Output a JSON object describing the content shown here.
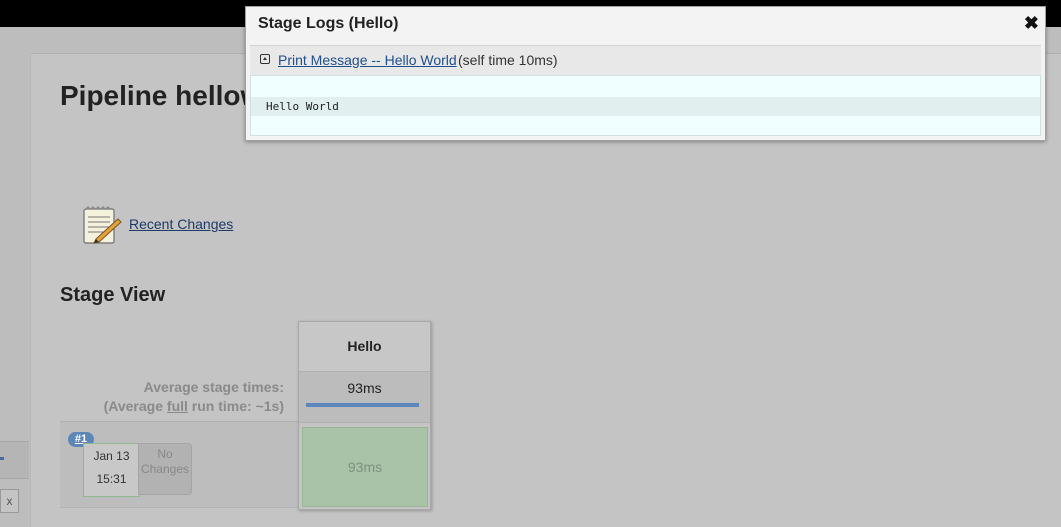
{
  "page": {
    "title": "Pipeline hellow"
  },
  "sidebar": {
    "close_label": "x"
  },
  "recent_changes": {
    "label": "Recent Changes",
    "icon": "notepad-pencil-icon"
  },
  "stage_view": {
    "title": "Stage View",
    "avg_stage_times_label": "Average stage times:",
    "avg_full_prefix": "(Average ",
    "avg_full_word": "full",
    "avg_full_suffix": " run time: ~1s)",
    "stages": [
      {
        "name": "Hello",
        "avg_time": "93ms",
        "avg_bar_fraction": 1.0
      }
    ],
    "runs": [
      {
        "badge": "#1",
        "date": "Jan 13",
        "time": "15:31",
        "changes_line1": "No",
        "changes_line2": "Changes",
        "stage_times": [
          "93ms"
        ]
      }
    ]
  },
  "modal": {
    "title": "Stage Logs (Hello)",
    "close_glyph": "✖",
    "step_link": "Print Message -- Hello World ",
    "self_time": "(self time 10ms)",
    "log_lines": [
      "Hello World"
    ]
  },
  "colors": {
    "success_cell": "#a9c3a8",
    "progress_bar": "#5d86bc",
    "link": "#1f4f8f"
  }
}
